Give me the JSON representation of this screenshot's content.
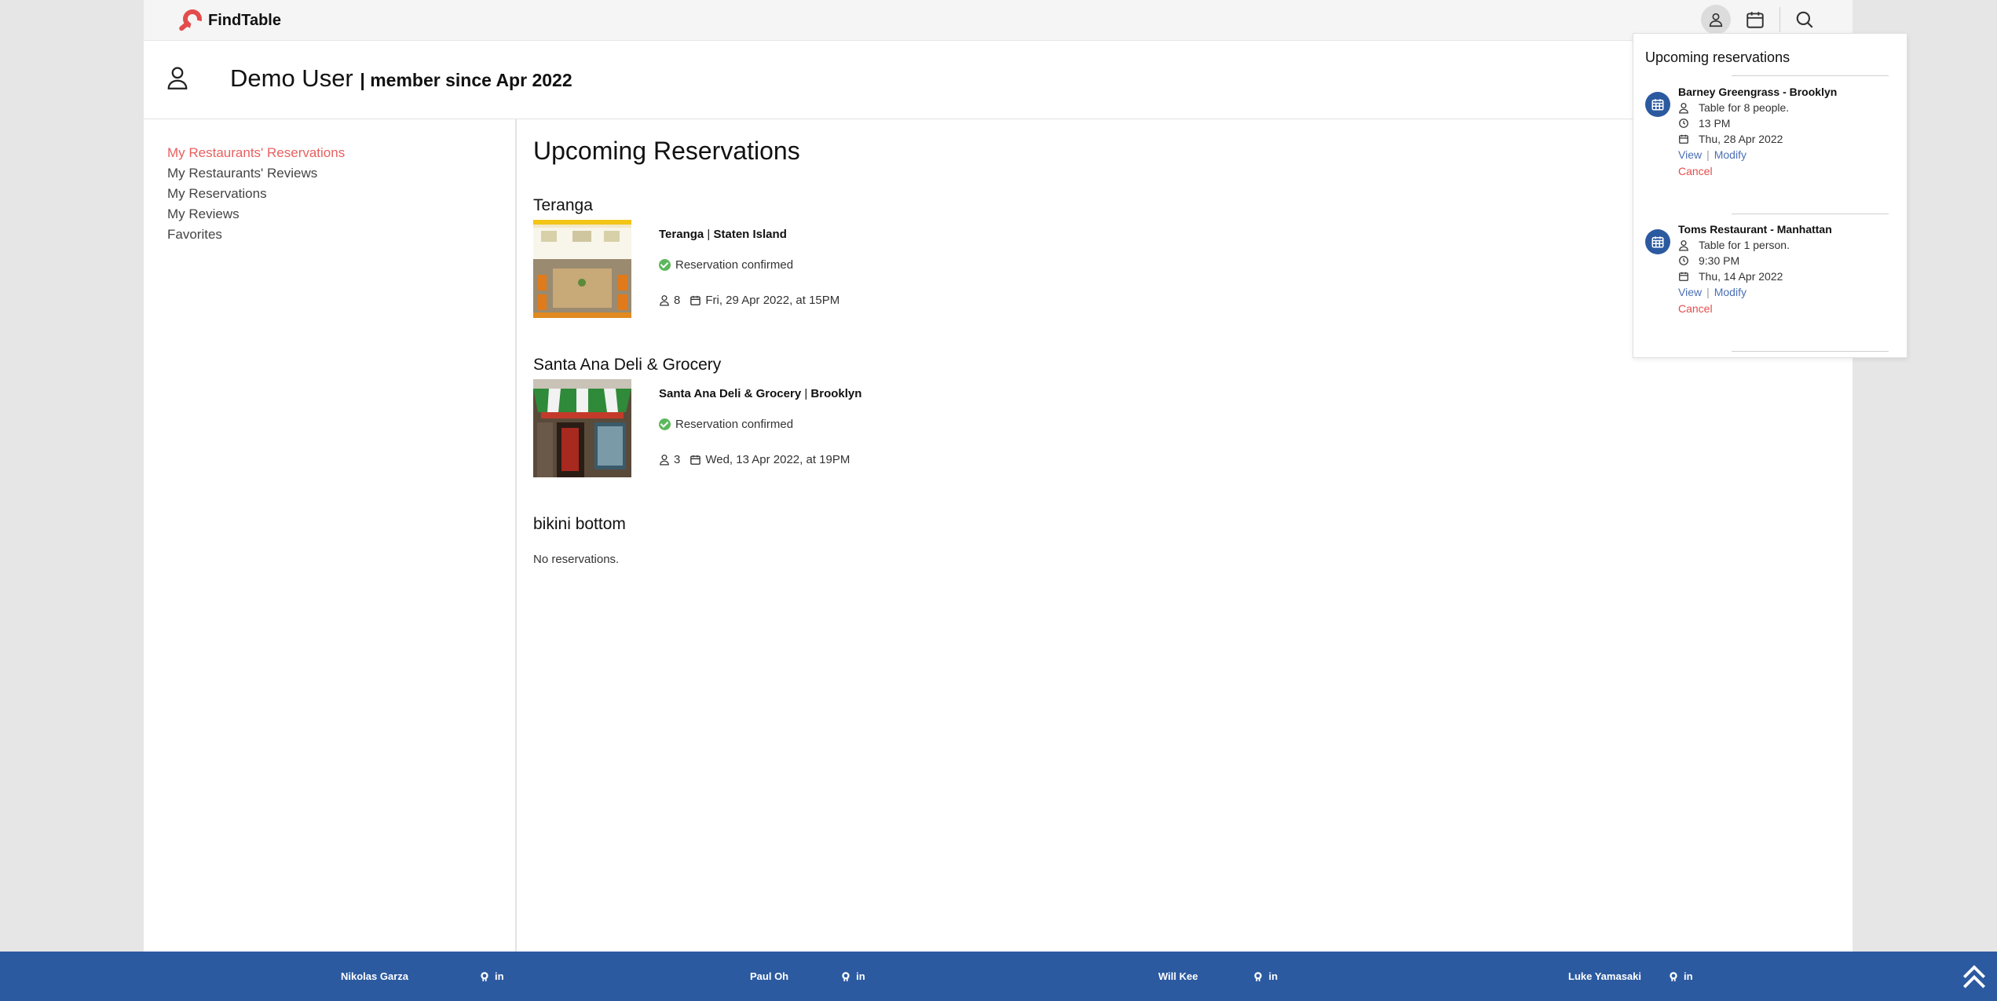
{
  "app": {
    "name": "FindTable",
    "accent": "#e34c4c",
    "brand_blue": "#2c5aa0"
  },
  "nav": {
    "icons": [
      "user-icon",
      "calendar-icon",
      "search-icon"
    ]
  },
  "profile": {
    "name": "Demo User",
    "since": "| member since Apr 2022"
  },
  "sidebar": {
    "items": [
      {
        "label": "My Restaurants' Reservations",
        "active": true
      },
      {
        "label": "My Restaurants' Reviews"
      },
      {
        "label": "My Reservations"
      },
      {
        "label": "My Reviews"
      },
      {
        "label": "Favorites"
      }
    ]
  },
  "main": {
    "title": "Upcoming Reservations",
    "restaurants": [
      {
        "title": "Teranga",
        "name": "Teranga",
        "borough": "Staten Island",
        "status": "Reservation confirmed",
        "guests": "8",
        "date": "Fri, 29 Apr 2022, at 15PM"
      },
      {
        "title": "Santa Ana Deli & Grocery",
        "name": "Santa Ana Deli & Grocery",
        "borough": "Brooklyn",
        "status": "Reservation confirmed",
        "guests": "3",
        "date": "Wed, 13 Apr 2022, at 19PM"
      },
      {
        "title": "bikini bottom",
        "empty": "No reservations."
      }
    ]
  },
  "popup": {
    "title": "Upcoming reservations",
    "reservations": [
      {
        "name": "Barney Greengrass - Brooklyn",
        "party": "Table for 8 people.",
        "time": "13 PM",
        "date": "Thu, 28 Apr 2022",
        "view": "View",
        "modify": "Modify",
        "cancel": "Cancel"
      },
      {
        "name": "Toms Restaurant - Manhattan",
        "party": "Table for 1 person.",
        "time": "9:30 PM",
        "date": "Thu, 14 Apr 2022",
        "view": "View",
        "modify": "Modify",
        "cancel": "Cancel"
      }
    ]
  },
  "footer": {
    "people": [
      {
        "name": "Nikolas Garza",
        "li": "in"
      },
      {
        "name": "Paul Oh",
        "li": "in"
      },
      {
        "name": "Will Kee",
        "li": "in"
      },
      {
        "name": "Luke Yamasaki",
        "li": "in"
      }
    ]
  }
}
